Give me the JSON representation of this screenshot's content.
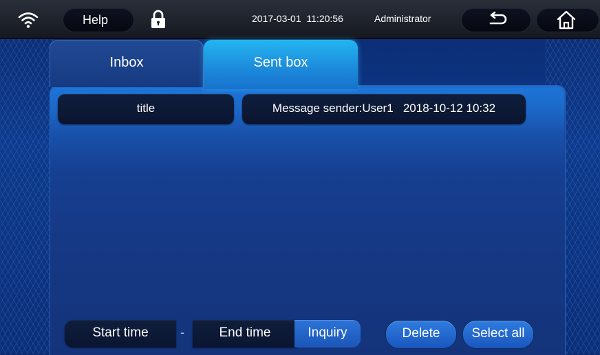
{
  "topbar": {
    "help_label": "Help",
    "datetime": "2017-03-01  11:20:56",
    "user": "Administrator",
    "icons": [
      "wifi-icon",
      "lock-icon",
      "back-arrow-icon",
      "home-icon"
    ]
  },
  "tabs": [
    {
      "label": "Inbox",
      "active": false
    },
    {
      "label": "Sent box",
      "active": true
    }
  ],
  "message_list": {
    "columns": [
      "title"
    ],
    "rows": [
      {
        "title": "",
        "summary": "Message sender:User1   2018-10-12 10:32"
      }
    ]
  },
  "filter": {
    "start_time_label": "Start time",
    "separator": "-",
    "end_time_label": "End time",
    "inquiry_label": "Inquiry"
  },
  "actions": {
    "delete_label": "Delete",
    "select_all_label": "Select all"
  },
  "colors": {
    "background": "#0d3a8c",
    "active_tab": "#23b6f0",
    "button_blue": "#2f7ce0",
    "dark_cell": "#0f1e3d"
  }
}
